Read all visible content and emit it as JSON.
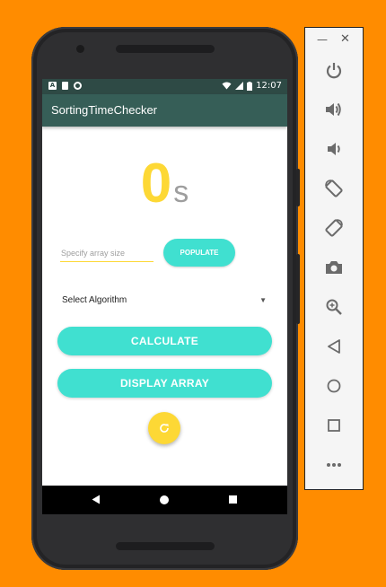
{
  "status_bar": {
    "time": "12:07"
  },
  "app": {
    "title": "SortingTimeChecker",
    "timer_value": "0",
    "timer_unit": "s",
    "array_size_placeholder": "Specify array size",
    "populate_label": "POPULATE",
    "algorithm_select": "Select Algorithm",
    "calculate_label": "CALCULATE",
    "display_array_label": "DISPLAY ARRAY",
    "refresh_icon": "refresh-icon"
  },
  "emulator_panel": {
    "window_controls": [
      "minimize-icon",
      "close-icon"
    ],
    "tools": [
      "power-icon",
      "volume-up-icon",
      "volume-down-icon",
      "rotate-left-icon",
      "rotate-right-icon",
      "camera-icon",
      "zoom-icon",
      "back-icon",
      "home-icon",
      "overview-icon",
      "more-icon"
    ]
  },
  "colors": {
    "background": "#FF8C00",
    "appbar": "#365e57",
    "accent_teal": "#40E0D0",
    "accent_yellow": "#FDD835"
  }
}
